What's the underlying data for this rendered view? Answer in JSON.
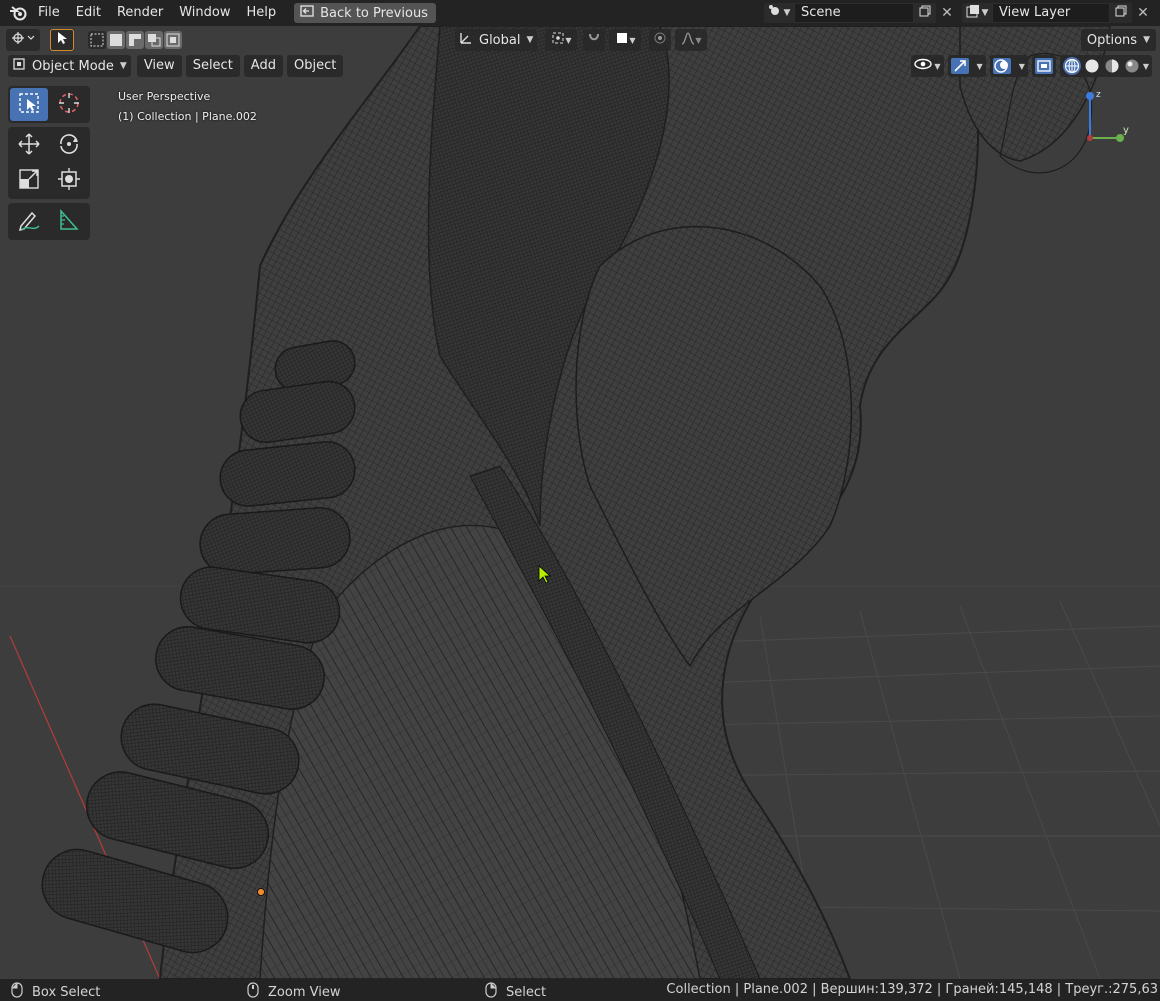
{
  "topbar": {
    "menus": [
      "File",
      "Edit",
      "Render",
      "Window",
      "Help"
    ],
    "back_button": "Back to Previous",
    "scene": "Scene",
    "view_layer": "View Layer"
  },
  "header": {
    "orientation": "Global",
    "options": "Options"
  },
  "mode_row": {
    "mode": "Object Mode",
    "menus": [
      "View",
      "Select",
      "Add",
      "Object"
    ]
  },
  "view_info": {
    "line1": "User Perspective",
    "line2": "(1) Collection | Plane.002"
  },
  "gizmo": {
    "y_label": "y",
    "z_label": "z"
  },
  "statusbar": {
    "left": "Box Select",
    "middle": "Zoom View",
    "right": "Select",
    "stats": "Collection | Plane.002 | Вершин:139,372 | Граней:145,148 | Треуг.:275,63"
  },
  "colors": {
    "accent": "#4772b3",
    "background": "#3d3d3d",
    "header": "#232323",
    "wire": "#1c1c1c",
    "cursor": "#b6f000",
    "origin_dot": "#f08c2a",
    "x_axis": "#b33c3c"
  },
  "icons": [
    "blender-logo",
    "back-icon",
    "scene-icon",
    "view-layer-icon",
    "copy-icon",
    "close-icon",
    "select-box-icon",
    "cursor-icon",
    "move-icon",
    "rotate-icon",
    "scale-icon",
    "transform-icon",
    "annotate-icon",
    "measure-icon",
    "orientation-icon",
    "pivot-icon",
    "snap-icon",
    "proportional-icon",
    "visibility-icon",
    "gizmo-icon",
    "overlay-icon",
    "xray-icon",
    "wireframe-shading-icon",
    "solid-shading-icon",
    "material-shading-icon",
    "rendered-shading-icon",
    "mouse-left-icon",
    "mouse-middle-icon",
    "mouse-right-icon"
  ]
}
